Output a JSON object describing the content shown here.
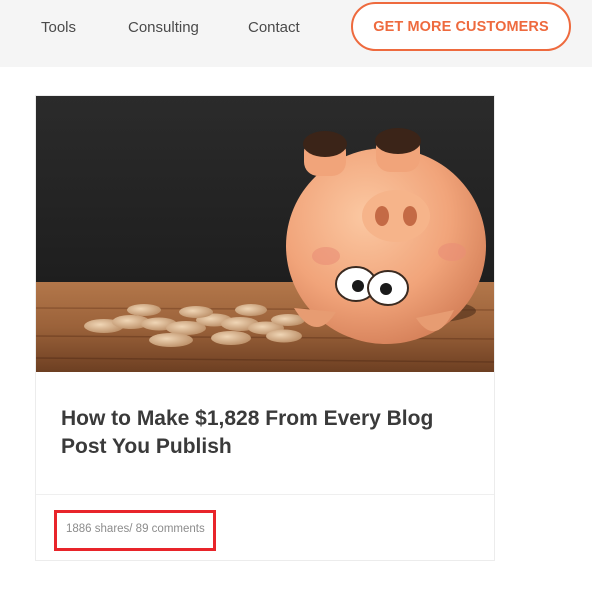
{
  "nav": {
    "items": [
      "Tools",
      "Consulting",
      "Contact"
    ],
    "cta_label": "GET MORE CUSTOMERS"
  },
  "post": {
    "title": "How to Make $1,828 From Every Blog Post You Publish",
    "shares": "1886 shares",
    "comments": "89 comments",
    "meta": "1886 shares/ 89 comments",
    "image_subject": "piggy-bank-with-coins"
  },
  "colors": {
    "accent": "#ee6a3e",
    "highlight": "#e8242a",
    "title": "#3a3a3a",
    "meta": "#8c8c8c",
    "header_bg": "#f5f5f5"
  }
}
